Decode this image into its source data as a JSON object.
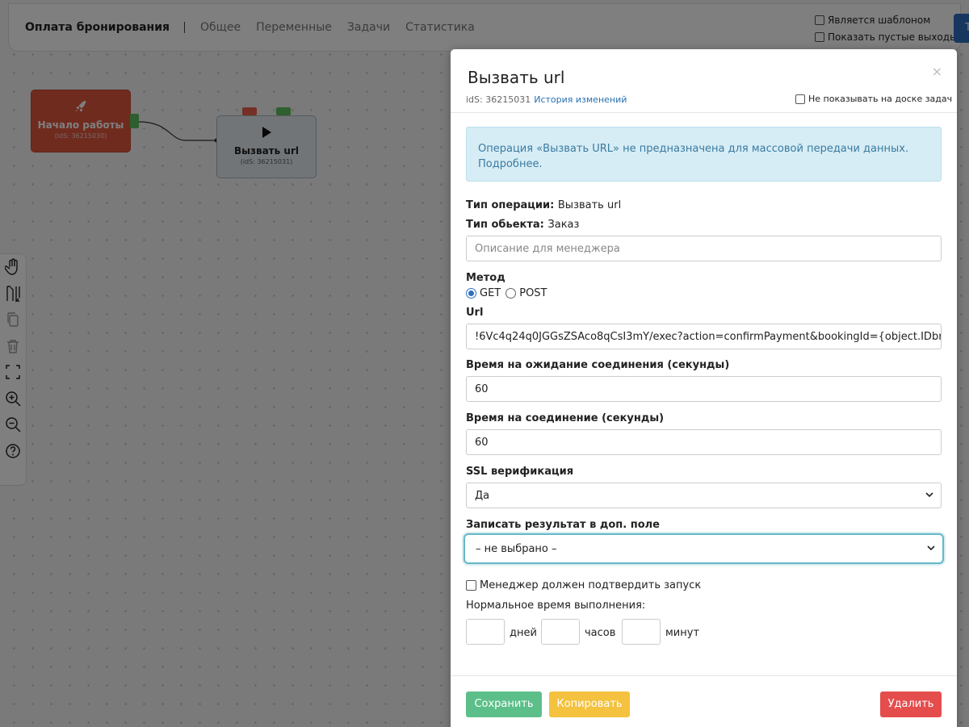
{
  "topbar": {
    "title": "Оплата бронирования",
    "tabs": [
      "Общее",
      "Переменные",
      "Задачи",
      "Статистика"
    ],
    "is_template_label": "Является шаблоном",
    "show_empty_label": "Показать пустые выходы",
    "right_button_label": "Т"
  },
  "nodes": {
    "start": {
      "name": "Начало работы",
      "id": "(idS: 36215030)"
    },
    "call": {
      "name": "Вызвать url",
      "id": "(idS: 36215031)"
    }
  },
  "modal": {
    "title": "Вызвать url",
    "ids": "idS: 36215031",
    "history_link": "История изменений",
    "hide_on_board_label": "Не показывать на доске задач",
    "alert_text": "Операция «Вызвать URL» не предназначена для массовой передачи данных.",
    "alert_link": "Подробнее.",
    "op_type_label": "Тип операции:",
    "op_type_value": "Вызвать url",
    "obj_type_label": "Тип обьекта:",
    "obj_type_value": "Заказ",
    "description_placeholder": "Описание для менеджера",
    "method_label": "Метод",
    "method_options": [
      "GET",
      "POST"
    ],
    "method_selected": "GET",
    "url_label": "Url",
    "url_value": "!6Vc4q24q0JGGsZSAco8qCsI3mY/exec?action=confirmPayment&bookingId={object.IDbron}",
    "wait_label": "Время на ожидание соединения (секунды)",
    "wait_value": "60",
    "conn_label": "Время на соединение (секунды)",
    "conn_value": "60",
    "ssl_label": "SSL верификация",
    "ssl_value": "Да",
    "result_label": "Записать результат в доп. поле",
    "result_value": "– не выбрано –",
    "confirm_label": "Менеджер должен подтвердить запуск",
    "normal_time_label": "Нормальное время выполнения:",
    "days_label": "дней",
    "hours_label": "часов",
    "minutes_label": "минут",
    "save_label": "Сохранить",
    "copy_label": "Копировать",
    "delete_label": "Удалить"
  },
  "colors": {
    "save": "#5cbf8a",
    "copy": "#f4c23e",
    "delete": "#e54d4d",
    "start_node": "#e0563f",
    "alert_bg": "#d6edf6"
  }
}
